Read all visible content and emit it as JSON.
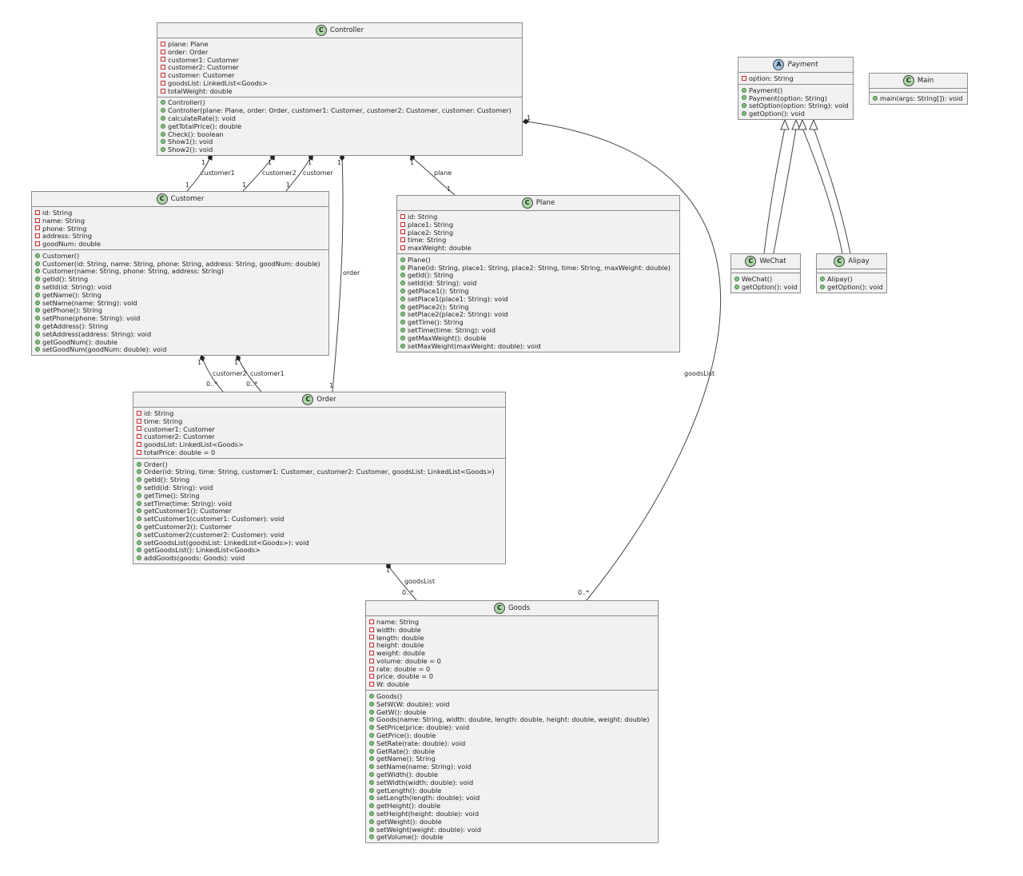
{
  "classes": {
    "controller": {
      "stereotype": "C",
      "name": "Controller",
      "fields": [
        {
          "vis": "private",
          "text": "plane: Plane"
        },
        {
          "vis": "private",
          "text": "order: Order"
        },
        {
          "vis": "private",
          "text": "customer1: Customer"
        },
        {
          "vis": "private",
          "text": "customer2: Customer"
        },
        {
          "vis": "private",
          "text": "customer: Customer"
        },
        {
          "vis": "private",
          "text": "goodsList: LinkedList<Goods>"
        },
        {
          "vis": "private",
          "text": "totalWeight: double"
        }
      ],
      "methods": [
        {
          "vis": "public",
          "text": "Controller()"
        },
        {
          "vis": "public",
          "text": "Controller(plane: Plane, order: Order, customer1: Customer, customer2: Customer, customer: Customer)"
        },
        {
          "vis": "public",
          "text": "calculateRate(): void"
        },
        {
          "vis": "public",
          "text": "getTotalPrice(): double"
        },
        {
          "vis": "public",
          "text": "Check(): boolean"
        },
        {
          "vis": "public",
          "text": "Show1(): void"
        },
        {
          "vis": "public",
          "text": "Show2(): void"
        }
      ]
    },
    "customer": {
      "stereotype": "C",
      "name": "Customer",
      "fields": [
        {
          "vis": "private",
          "text": "id: String"
        },
        {
          "vis": "private",
          "text": "name: String"
        },
        {
          "vis": "private",
          "text": "phone: String"
        },
        {
          "vis": "private",
          "text": "address: String"
        },
        {
          "vis": "private",
          "text": "goodNum: double"
        }
      ],
      "methods": [
        {
          "vis": "public",
          "text": "Customer()"
        },
        {
          "vis": "public",
          "text": "Customer(id: String, name: String, phone: String, address: String, goodNum: double)"
        },
        {
          "vis": "public",
          "text": "Customer(name: String, phone: String, address: String)"
        },
        {
          "vis": "public",
          "text": "getId(): String"
        },
        {
          "vis": "public",
          "text": "setId(id: String): void"
        },
        {
          "vis": "public",
          "text": "getName(): String"
        },
        {
          "vis": "public",
          "text": "setName(name: String): void"
        },
        {
          "vis": "public",
          "text": "getPhone(): String"
        },
        {
          "vis": "public",
          "text": "setPhone(phone: String): void"
        },
        {
          "vis": "public",
          "text": "getAddress(): String"
        },
        {
          "vis": "public",
          "text": "setAddress(address: String): void"
        },
        {
          "vis": "public",
          "text": "getGoodNum(): double"
        },
        {
          "vis": "public",
          "text": "setGoodNum(goodNum: double): void"
        }
      ]
    },
    "plane": {
      "stereotype": "C",
      "name": "Plane",
      "fields": [
        {
          "vis": "private",
          "text": "id: String"
        },
        {
          "vis": "private",
          "text": "place1: String"
        },
        {
          "vis": "private",
          "text": "place2: String"
        },
        {
          "vis": "private",
          "text": "time: String"
        },
        {
          "vis": "private",
          "text": "maxWeight: double"
        }
      ],
      "methods": [
        {
          "vis": "public",
          "text": "Plane()"
        },
        {
          "vis": "public",
          "text": "Plane(id: String, place1: String, place2: String, time: String, maxWeight: double)"
        },
        {
          "vis": "public",
          "text": "getId(): String"
        },
        {
          "vis": "public",
          "text": "setId(id: String): void"
        },
        {
          "vis": "public",
          "text": "getPlace1(): String"
        },
        {
          "vis": "public",
          "text": "setPlace1(place1: String): void"
        },
        {
          "vis": "public",
          "text": "getPlace2(): String"
        },
        {
          "vis": "public",
          "text": "setPlace2(place2: String): void"
        },
        {
          "vis": "public",
          "text": "getTime(): String"
        },
        {
          "vis": "public",
          "text": "setTime(time: String): void"
        },
        {
          "vis": "public",
          "text": "getMaxWeight(): double"
        },
        {
          "vis": "public",
          "text": "setMaxWeight(maxWeight: double): void"
        }
      ]
    },
    "order": {
      "stereotype": "C",
      "name": "Order",
      "fields": [
        {
          "vis": "private",
          "text": "id: String"
        },
        {
          "vis": "private",
          "text": "time: String"
        },
        {
          "vis": "private",
          "text": "customer1: Customer"
        },
        {
          "vis": "private",
          "text": "customer2: Customer"
        },
        {
          "vis": "private",
          "text": "goodsList: LinkedList<Goods>"
        },
        {
          "vis": "private",
          "text": "totalPrice: double = 0"
        }
      ],
      "methods": [
        {
          "vis": "public",
          "text": "Order()"
        },
        {
          "vis": "public",
          "text": "Order(id: String, time: String, customer1: Customer, customer2: Customer, goodsList: LinkedList<Goods>)"
        },
        {
          "vis": "public",
          "text": "getId(): String"
        },
        {
          "vis": "public",
          "text": "setId(id: String): void"
        },
        {
          "vis": "public",
          "text": "getTime(): String"
        },
        {
          "vis": "public",
          "text": "setTime(time: String): void"
        },
        {
          "vis": "public",
          "text": "getCustomer1(): Customer"
        },
        {
          "vis": "public",
          "text": "setCustomer1(customer1: Customer): void"
        },
        {
          "vis": "public",
          "text": "getCustomer2(): Customer"
        },
        {
          "vis": "public",
          "text": "setCustomer2(customer2: Customer): void"
        },
        {
          "vis": "public",
          "text": "setGoodsList(goodsList: LinkedList<Goods>): void"
        },
        {
          "vis": "public",
          "text": "getGoodsList(): LinkedList<Goods>"
        },
        {
          "vis": "public",
          "text": "addGoods(goods: Goods): void"
        }
      ]
    },
    "goods": {
      "stereotype": "C",
      "name": "Goods",
      "fields": [
        {
          "vis": "private",
          "text": "name: String"
        },
        {
          "vis": "private",
          "text": "width: double"
        },
        {
          "vis": "private",
          "text": "length: double"
        },
        {
          "vis": "private",
          "text": "height: double"
        },
        {
          "vis": "private",
          "text": "weight: double"
        },
        {
          "vis": "private",
          "text": "volume: double = 0"
        },
        {
          "vis": "private",
          "text": "rate: double = 0"
        },
        {
          "vis": "private",
          "text": "price: double = 0"
        },
        {
          "vis": "private",
          "text": "W: double"
        }
      ],
      "methods": [
        {
          "vis": "public",
          "text": "Goods()"
        },
        {
          "vis": "public",
          "text": "SetW(W: double): void"
        },
        {
          "vis": "public",
          "text": "GetW(): double"
        },
        {
          "vis": "public",
          "text": "Goods(name: String, width: double, length: double, height: double, weight: double)"
        },
        {
          "vis": "public",
          "text": "SetPrice(price: double): void"
        },
        {
          "vis": "public",
          "text": "GetPrice(): double"
        },
        {
          "vis": "public",
          "text": "SetRate(rate: double): void"
        },
        {
          "vis": "public",
          "text": "GetRate(): double"
        },
        {
          "vis": "public",
          "text": "getName(): String"
        },
        {
          "vis": "public",
          "text": "setName(name: String): void"
        },
        {
          "vis": "public",
          "text": "getWidth(): double"
        },
        {
          "vis": "public",
          "text": "setWidth(width: double): void"
        },
        {
          "vis": "public",
          "text": "getLength(): double"
        },
        {
          "vis": "public",
          "text": "setLength(length: double): void"
        },
        {
          "vis": "public",
          "text": "getHeight(): double"
        },
        {
          "vis": "public",
          "text": "setHeight(height: double): void"
        },
        {
          "vis": "public",
          "text": "getWeight(): double"
        },
        {
          "vis": "public",
          "text": "setWeight(weight: double): void"
        },
        {
          "vis": "public",
          "text": "getVolume(): double"
        }
      ]
    },
    "payment": {
      "stereotype": "A",
      "name": "Payment",
      "fields": [
        {
          "vis": "private",
          "text": "option: String"
        }
      ],
      "methods": [
        {
          "vis": "public",
          "text": "Payment()"
        },
        {
          "vis": "public",
          "text": "Payment(option: String)"
        },
        {
          "vis": "public",
          "text": "setOption(option: String): void"
        },
        {
          "vis": "public",
          "text": "getOption(): void"
        }
      ]
    },
    "main": {
      "stereotype": "C",
      "name": "Main",
      "fields": [],
      "methods": [
        {
          "vis": "public",
          "text": "main(args: String[]): void"
        }
      ]
    },
    "wechat": {
      "stereotype": "C",
      "name": "WeChat",
      "fields": [],
      "methods": [
        {
          "vis": "public",
          "text": "WeChat()"
        },
        {
          "vis": "public",
          "text": "getOption(): void"
        }
      ]
    },
    "alipay": {
      "stereotype": "C",
      "name": "Alipay",
      "fields": [],
      "methods": [
        {
          "vis": "public",
          "text": "Alipay()"
        },
        {
          "vis": "public",
          "text": "getOption(): void"
        }
      ]
    }
  },
  "edges": {
    "ctrl_customer1": {
      "label": "customer1",
      "from_mult": "1",
      "to_mult": "1"
    },
    "ctrl_customer2": {
      "label": "customer2",
      "from_mult": "1",
      "to_mult": "1"
    },
    "ctrl_customer": {
      "label": "customer",
      "from_mult": "1",
      "to_mult": "1"
    },
    "ctrl_order": {
      "label": "order",
      "from_mult": "1",
      "to_mult": "1"
    },
    "ctrl_plane": {
      "label": "plane",
      "from_mult": "1",
      "to_mult": "1"
    },
    "ctrl_goods": {
      "label": "goodsList",
      "from_mult": "1",
      "to_mult": "0..*"
    },
    "cust_order2": {
      "label": "customer2",
      "from_mult": "1",
      "to_mult": "0..*"
    },
    "cust_order1": {
      "label": "customer1",
      "from_mult": "1",
      "to_mult": "0..*"
    },
    "order_goods": {
      "label": "goodsList",
      "from_mult": "1",
      "to_mult": "0..*"
    }
  },
  "colors": {
    "class_fill": "#f1f1f1",
    "border": "#8c8c8c",
    "class_badge": "#a9d7a4",
    "abstract_badge": "#9fc6ea",
    "public_marker": "#84be84",
    "private_marker": "#c82930"
  }
}
